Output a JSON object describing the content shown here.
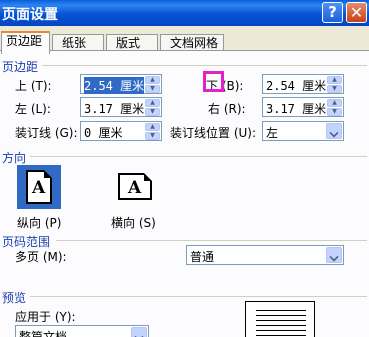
{
  "window": {
    "title": "页面设置",
    "help_icon": "?",
    "close_icon": "✕"
  },
  "tabs": [
    {
      "label": "页边距",
      "active": true
    },
    {
      "label": "纸张",
      "active": false
    },
    {
      "label": "版式",
      "active": false
    },
    {
      "label": "文档网格",
      "active": false
    }
  ],
  "margins": {
    "section_title": "页边距",
    "top": {
      "label": "上 (T):",
      "value": "2.54 厘米"
    },
    "bottom": {
      "label": "下 (B):",
      "value": "2.54 厘米"
    },
    "left": {
      "label": "左 (L):",
      "value": "3.17 厘米"
    },
    "right": {
      "label": "右 (R):",
      "value": "3.17 厘米"
    },
    "gutter": {
      "label": "装订线 (G):",
      "value": "0 厘米"
    },
    "gutter_position": {
      "label": "装订线位置 (U):",
      "value": "左"
    }
  },
  "orientation": {
    "section_title": "方向",
    "portrait_label": "纵向 (P)",
    "landscape_label": "横向 (S)",
    "glyph": "A"
  },
  "pages": {
    "section_title": "页码范围",
    "multiple_label": "多页 (M):",
    "multiple_value": "普通"
  },
  "preview": {
    "section_title": "预览",
    "apply_label": "应用于 (Y):",
    "apply_value": "整篇文档"
  }
}
